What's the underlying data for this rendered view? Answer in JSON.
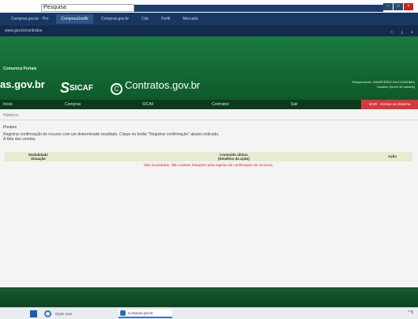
{
  "search": {
    "value": "Pesquisa"
  },
  "tabs": [
    {
      "label": "Compras.gov.br · Pro"
    },
    {
      "label": "ComprasGovBr"
    },
    {
      "label": "Compras.gov.br"
    },
    {
      "label": "Cdc"
    },
    {
      "label": "Perfil"
    },
    {
      "label": "Mercado"
    }
  ],
  "address": {
    "url": "www.gov.br/contratos"
  },
  "header": {
    "section": "Comunica Portais",
    "logo1": "as.gov.br",
    "logo2": "SICAF",
    "logo3": "Contratos.gov.br",
    "account_lines": [
      "Responsável:: MINISTÉRIO DA ECONOMIA",
      "Usuário: [nome do usuário]"
    ]
  },
  "nav": {
    "items": [
      "Início",
      "Compras",
      "SICAF",
      "Contratos",
      "Sair"
    ],
    "alert": "SAIR · Acesso ao Sistema"
  },
  "content": {
    "breadcrumb": "Histórico",
    "section_title": "Prestes",
    "hint_line1": "Registrar confirmação de recurso com um determinado resultado. Clique no botão \"Registrar confirmação\" abaixo indicado.",
    "hint_line2": "A lista das vendas."
  },
  "table": {
    "col1_line1": "Modalidade",
    "col1_line2": "Situação",
    "col2_line1": "Conteúdo último",
    "col2_line2": "(Detalhes da ação)",
    "col3": "Ação",
    "empty_message": "Não encontrado. Não existem licitações para registro da confirmação de recursos."
  },
  "taskbar": {
    "search_text": "Digite aqui",
    "app_label": "Compras.gov.br",
    "tray": "^ 5"
  }
}
